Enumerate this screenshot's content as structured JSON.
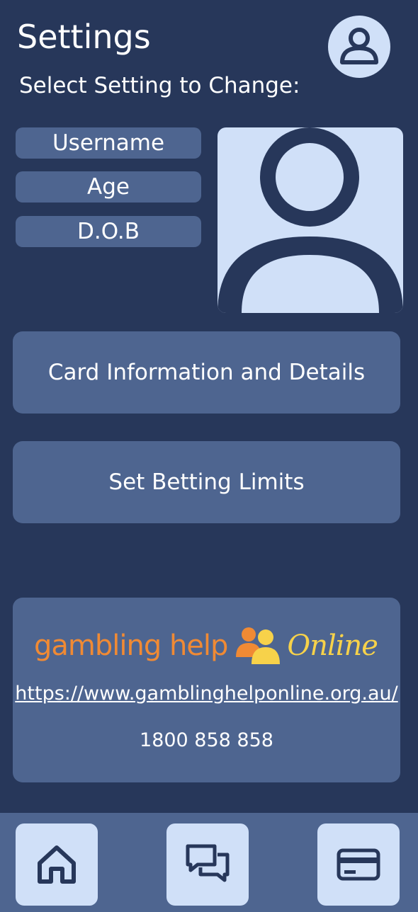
{
  "header": {
    "title": "Settings",
    "profile_icon": "user-circle-icon"
  },
  "subtitle": "Select Setting to Change:",
  "settings_options": [
    {
      "label": "Username"
    },
    {
      "label": "Age"
    },
    {
      "label": "D.O.B"
    }
  ],
  "avatar_icon": "user-avatar-icon",
  "actions": {
    "card_info_label": "Card Information and Details",
    "betting_limits_label": "Set Betting Limits"
  },
  "help": {
    "logo_text_main": "gambling help",
    "logo_text_online": "Online",
    "logo_icon": "people-icon",
    "url": "https://www.gamblinghelponline.org.au/",
    "phone": "1800 858 858"
  },
  "bottom_nav": {
    "items": [
      {
        "icon": "home-icon"
      },
      {
        "icon": "chat-icon"
      },
      {
        "icon": "credit-card-icon"
      }
    ]
  },
  "colors": {
    "background": "#27375a",
    "panel": "#4e6590",
    "light": "#d0e0f8",
    "logo_orange": "#f08a34",
    "logo_yellow": "#f7d24a"
  }
}
